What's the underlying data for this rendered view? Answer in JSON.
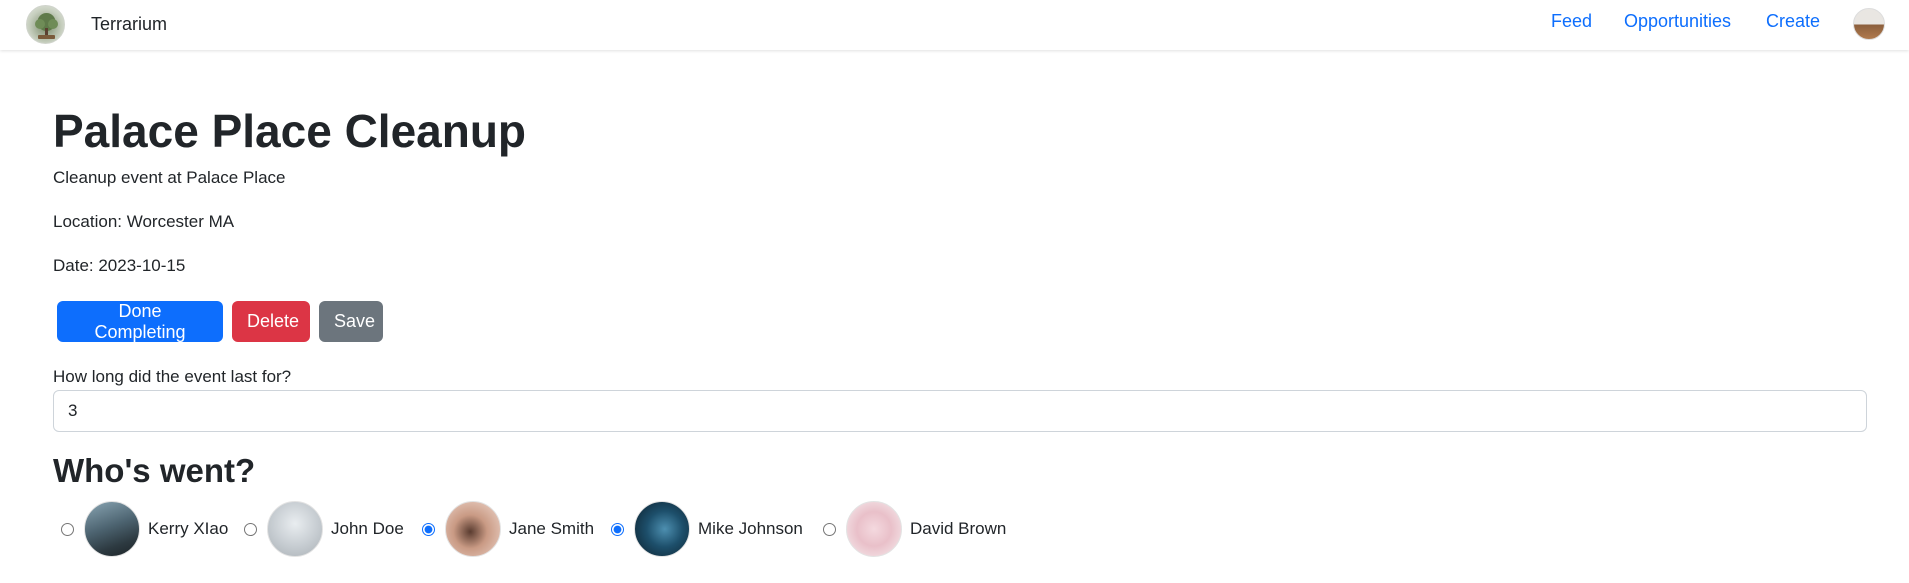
{
  "nav": {
    "brand": "Terrarium",
    "links": [
      "Feed",
      "Opportunities",
      "Create"
    ]
  },
  "event": {
    "title": "Palace Place Cleanup",
    "description": "Cleanup event at Palace Place",
    "location": "Location: Worcester MA",
    "date": "Date: 2023-10-15"
  },
  "actions": {
    "done_label": "Done Completing",
    "delete_label": "Delete",
    "save_label": "Save"
  },
  "duration": {
    "label": "How long did the event last for?",
    "value": "3"
  },
  "attendance": {
    "heading": "Who's went?",
    "people": [
      {
        "name": "Kerry XIao",
        "selected": false
      },
      {
        "name": "John Doe",
        "selected": false
      },
      {
        "name": "Jane Smith",
        "selected": true
      },
      {
        "name": "Mike Johnson",
        "selected": true
      },
      {
        "name": "David Brown",
        "selected": false
      }
    ]
  },
  "colors": {
    "primary": "#0d6efd",
    "danger": "#dc3545",
    "secondary": "#6c757d"
  }
}
